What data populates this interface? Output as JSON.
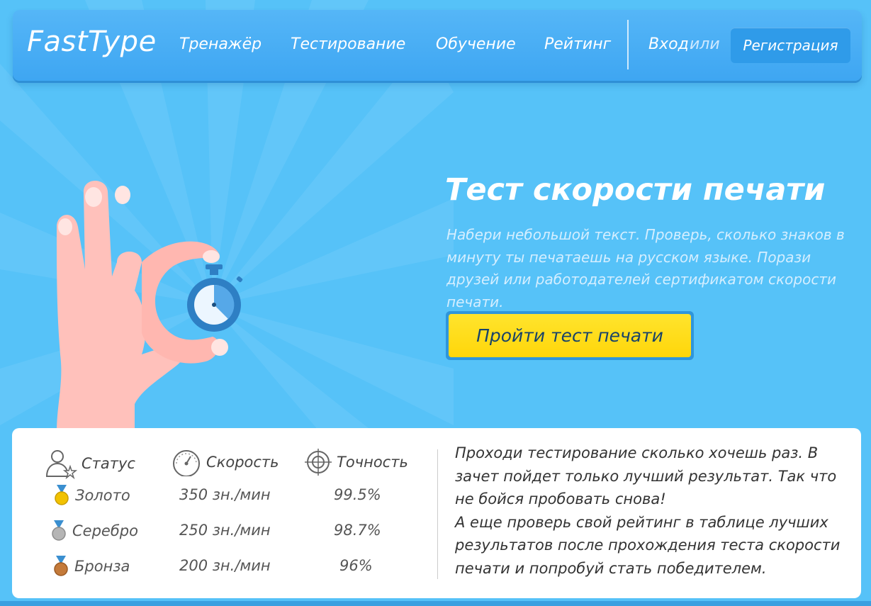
{
  "nav": {
    "logo": "FastType",
    "links": [
      "Тренажёр",
      "Тестирование",
      "Обучение",
      "Рейтинг"
    ],
    "login": "Вход",
    "or": "или",
    "register": "Регистрация"
  },
  "hero": {
    "title": "Тест скорости печати",
    "description": "Набери небольшой текст. Проверь, сколько знаков в минуту ты печатаешь на русском языке. Порази друзей или работодателей сертификатом скорости печати.",
    "cta": "Пройти тест печати"
  },
  "stats": {
    "headers": {
      "status": "Статус",
      "speed": "Скорость",
      "accuracy": "Точность"
    },
    "rows": [
      {
        "medal": "Золото",
        "speed": "350 зн./мин",
        "accuracy": "99.5%",
        "color": "#f2c200"
      },
      {
        "medal": "Серебро",
        "speed": "250 зн./мин",
        "accuracy": "98.7%",
        "color": "#b5b5b5"
      },
      {
        "medal": "Бронза",
        "speed": "200 зн./мин",
        "accuracy": "96%",
        "color": "#c47a3a"
      }
    ],
    "text1": "Проходи тестирование сколько хочешь раз. В зачет пойдет только лучший результат. Так что не бойся пробовать снова!",
    "text2": "А еще проверь свой рейтинг в таблице лучших результатов после прохождения теста скорости печати и попробуй стать победителем."
  },
  "colors": {
    "background": "#56c2f8",
    "navbar": "#45aef4",
    "cta": "#ffdd1c",
    "cta_text": "#18436a"
  }
}
